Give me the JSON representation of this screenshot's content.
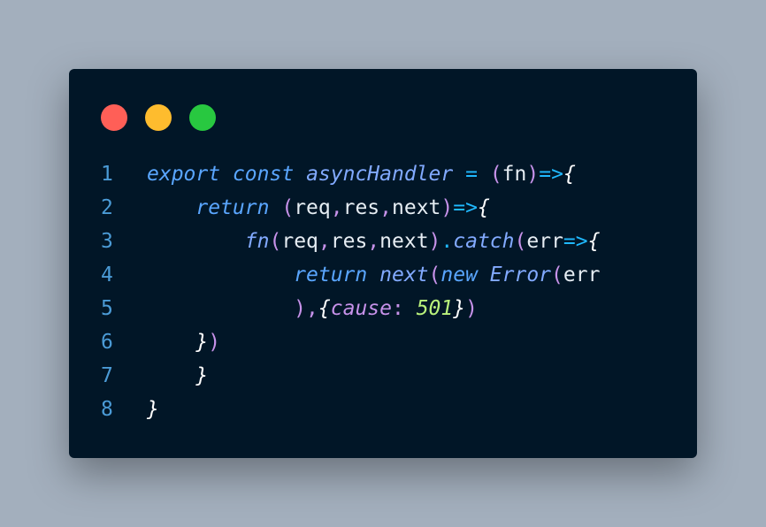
{
  "window": {
    "dots": [
      {
        "name": "close",
        "color": "#ff5f57"
      },
      {
        "name": "minimize",
        "color": "#febc2e"
      },
      {
        "name": "maximize",
        "color": "#28c840"
      }
    ]
  },
  "code": {
    "lines": [
      {
        "number": "1",
        "tokens": [
          {
            "t": "export",
            "c": "kw"
          },
          {
            "t": " ",
            "c": "plain"
          },
          {
            "t": "const",
            "c": "kw"
          },
          {
            "t": " ",
            "c": "plain"
          },
          {
            "t": "asyncHandler",
            "c": "fnname"
          },
          {
            "t": " ",
            "c": "plain"
          },
          {
            "t": "=",
            "c": "arrow"
          },
          {
            "t": " ",
            "c": "plain"
          },
          {
            "t": "(",
            "c": "punc"
          },
          {
            "t": "fn",
            "c": "plain"
          },
          {
            "t": ")",
            "c": "punc"
          },
          {
            "t": "=>",
            "c": "arrow"
          },
          {
            "t": "{",
            "c": "brace"
          }
        ]
      },
      {
        "number": "2",
        "tokens": [
          {
            "t": "    ",
            "c": "plain"
          },
          {
            "t": "return",
            "c": "kw"
          },
          {
            "t": " ",
            "c": "plain"
          },
          {
            "t": "(",
            "c": "punc"
          },
          {
            "t": "req",
            "c": "plain"
          },
          {
            "t": ",",
            "c": "punc"
          },
          {
            "t": "res",
            "c": "plain"
          },
          {
            "t": ",",
            "c": "punc"
          },
          {
            "t": "next",
            "c": "plain"
          },
          {
            "t": ")",
            "c": "punc"
          },
          {
            "t": "=>",
            "c": "arrow"
          },
          {
            "t": "{",
            "c": "brace"
          }
        ]
      },
      {
        "number": "3",
        "tokens": [
          {
            "t": "        ",
            "c": "plain"
          },
          {
            "t": "fn",
            "c": "fnname"
          },
          {
            "t": "(",
            "c": "punc"
          },
          {
            "t": "req",
            "c": "plain"
          },
          {
            "t": ",",
            "c": "punc"
          },
          {
            "t": "res",
            "c": "plain"
          },
          {
            "t": ",",
            "c": "punc"
          },
          {
            "t": "next",
            "c": "plain"
          },
          {
            "t": ")",
            "c": "punc"
          },
          {
            "t": ".",
            "c": "arrow"
          },
          {
            "t": "catch",
            "c": "fnname"
          },
          {
            "t": "(",
            "c": "punc"
          },
          {
            "t": "err",
            "c": "plain"
          },
          {
            "t": "=>",
            "c": "arrow"
          },
          {
            "t": "{",
            "c": "brace"
          }
        ]
      },
      {
        "number": "4",
        "tokens": [
          {
            "t": "            ",
            "c": "plain"
          },
          {
            "t": "return",
            "c": "kw"
          },
          {
            "t": " ",
            "c": "plain"
          },
          {
            "t": "next",
            "c": "fnname"
          },
          {
            "t": "(",
            "c": "punc"
          },
          {
            "t": "new",
            "c": "kw"
          },
          {
            "t": " ",
            "c": "plain"
          },
          {
            "t": "Error",
            "c": "cls"
          },
          {
            "t": "(",
            "c": "punc"
          },
          {
            "t": "err",
            "c": "plain"
          }
        ]
      },
      {
        "number": "5",
        "tokens": [
          {
            "t": "            ",
            "c": "plain"
          },
          {
            "t": ")",
            "c": "punc"
          },
          {
            "t": ",",
            "c": "punc"
          },
          {
            "t": "{",
            "c": "brace"
          },
          {
            "t": "cause",
            "c": "prop"
          },
          {
            "t": ": ",
            "c": "punc"
          },
          {
            "t": "501",
            "c": "num"
          },
          {
            "t": "}",
            "c": "brace"
          },
          {
            "t": ")",
            "c": "punc"
          }
        ]
      },
      {
        "number": "6",
        "tokens": [
          {
            "t": "    ",
            "c": "plain"
          },
          {
            "t": "}",
            "c": "brace"
          },
          {
            "t": ")",
            "c": "punc"
          }
        ]
      },
      {
        "number": "7",
        "tokens": [
          {
            "t": "    ",
            "c": "plain"
          },
          {
            "t": "}",
            "c": "brace"
          }
        ]
      },
      {
        "number": "8",
        "tokens": [
          {
            "t": "}",
            "c": "brace"
          }
        ]
      }
    ]
  }
}
